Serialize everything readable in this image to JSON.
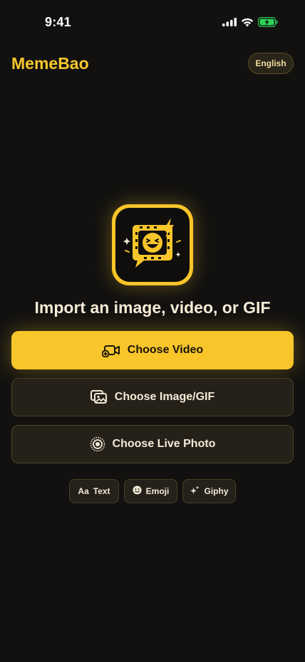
{
  "status_bar": {
    "time": "9:41"
  },
  "header": {
    "title": "MemeBao",
    "language_button": "English"
  },
  "main": {
    "headline": "Import an image, video, or GIF",
    "buttons": {
      "video": "Choose Video",
      "image": "Choose Image/GIF",
      "live": "Choose Live Photo"
    },
    "chips": {
      "text": "Text",
      "text_icon": "Aa",
      "emoji": "Emoji",
      "giphy": "Giphy"
    }
  },
  "colors": {
    "accent": "#f8c52a",
    "background": "#121110",
    "surface": "#252119"
  },
  "icons": [
    "video-plus-icon",
    "images-icon",
    "live-photo-icon",
    "emoji-icon",
    "sparkle-icon",
    "memebao-logo-icon"
  ]
}
